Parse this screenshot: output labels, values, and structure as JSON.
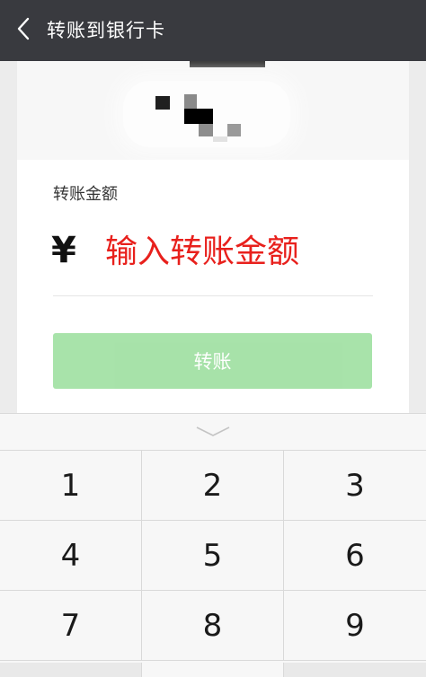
{
  "navbar": {
    "back_icon": "chevron-left-icon",
    "title": "转账到银行卡"
  },
  "form": {
    "amount_label": "转账金额",
    "currency_symbol": "¥",
    "amount_placeholder": "输入转账金额",
    "amount_value": "",
    "transfer_button_label": "转账"
  },
  "keyboard": {
    "collapse_icon": "chevron-down-icon",
    "keys": [
      "1",
      "2",
      "3",
      "4",
      "5",
      "6",
      "7",
      "8",
      "9"
    ]
  },
  "colors": {
    "navbar_bg": "#393a3f",
    "placeholder_red": "#e8201c",
    "button_green_disabled": "#a3e1a5"
  }
}
